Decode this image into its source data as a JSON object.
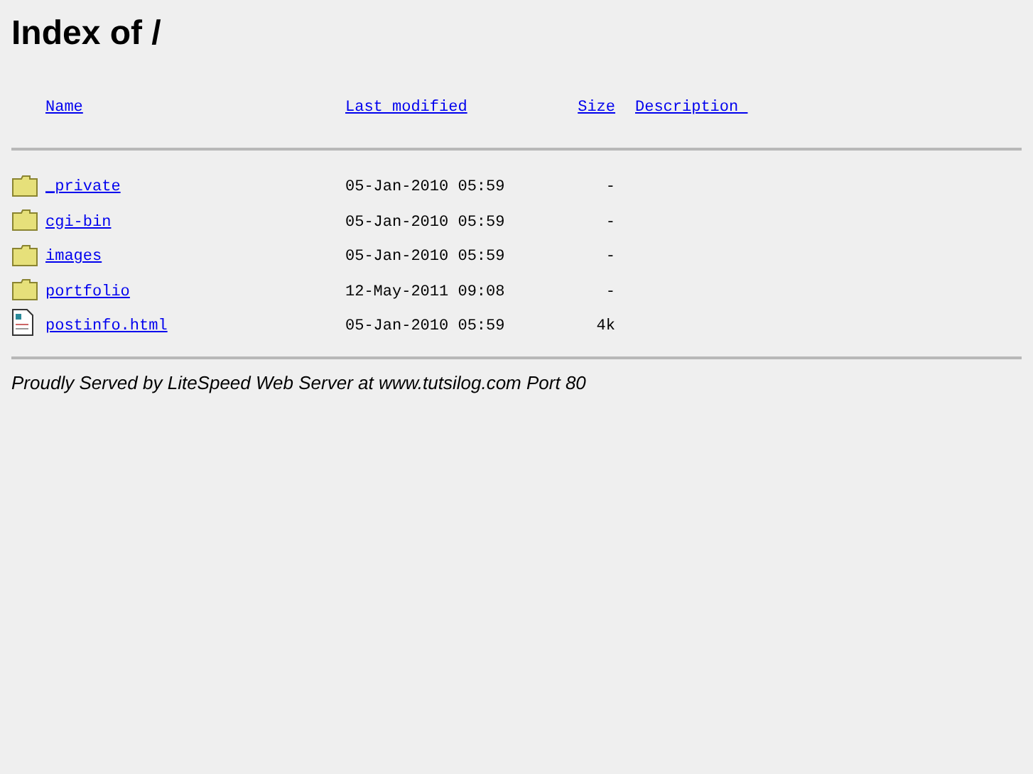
{
  "title": "Index of /",
  "columns": [
    {
      "label": "Name"
    },
    {
      "label": "Last modified"
    },
    {
      "label": "Size"
    },
    {
      "label": "Description "
    }
  ],
  "rows": [
    {
      "kind": "folder",
      "name": "_private",
      "modified": "05-Jan-2010 05:59",
      "size": "-"
    },
    {
      "kind": "folder",
      "name": "cgi-bin",
      "modified": "05-Jan-2010 05:59",
      "size": "-"
    },
    {
      "kind": "folder",
      "name": "images",
      "modified": "05-Jan-2010 05:59",
      "size": "-"
    },
    {
      "kind": "folder",
      "name": "portfolio",
      "modified": "12-May-2011 09:08",
      "size": "-"
    },
    {
      "kind": "file",
      "name": "postinfo.html",
      "modified": "05-Jan-2010 05:59",
      "size": "4k"
    }
  ],
  "footer": "Proudly Served by LiteSpeed Web Server at www.tutsilog.com Port 80"
}
